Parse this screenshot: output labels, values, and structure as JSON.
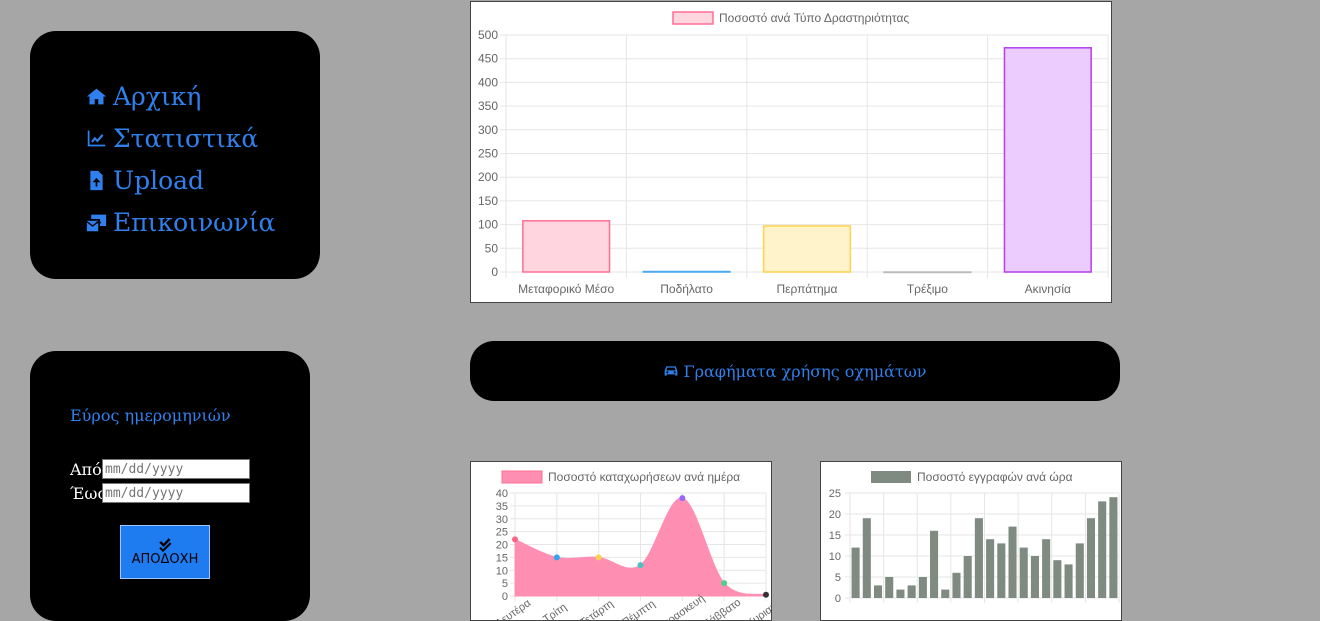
{
  "nav": {
    "items": [
      {
        "label": "Αρχική",
        "icon": "home-icon"
      },
      {
        "label": "Στατιστικά",
        "icon": "line-chart-icon"
      },
      {
        "label": "Upload",
        "icon": "file-upload-icon"
      },
      {
        "label": "Επικοινωνία",
        "icon": "mail-bulk-icon"
      }
    ],
    "color": "#2f80ed"
  },
  "date_filter": {
    "title": "Εύρος ημερομηνιών",
    "from_label": "Από",
    "to_label": "Έως",
    "from_placeholder": "mm/dd/yyyy",
    "to_placeholder": "mm/dd/yyyy",
    "accept_label": "ΑΠΟΔΟΧΗ",
    "accept_icon": "double-check-icon"
  },
  "vehicle_button": {
    "label": "Γραφήματα χρήσης οχημάτων",
    "icon": "car-icon"
  },
  "chart_data": [
    {
      "type": "bar",
      "legend": "Ποσοστό ανά Τύπο Δραστηριότητας",
      "categories": [
        "Μεταφορικό Μέσο",
        "Ποδήλατο",
        "Περπάτημα",
        "Τρέξιμο",
        "Ακινησία"
      ],
      "values": [
        108,
        1,
        97,
        0,
        473
      ],
      "ylim": [
        0,
        500
      ],
      "yticks": [
        0,
        50,
        100,
        150,
        200,
        250,
        300,
        350,
        400,
        450,
        500
      ],
      "grid": true,
      "legend_position": "top",
      "fill_colors": [
        "#ffd6e0",
        "#d6ecff",
        "#fff3cc",
        "#ffffff",
        "#ecccff"
      ],
      "stroke_colors": [
        "#ff6f95",
        "#4aa8f0",
        "#ffd24a",
        "#bbbbbb",
        "#b23ff0"
      ]
    },
    {
      "type": "area",
      "legend": "Ποσοστό καταχωρήσεων ανά ημέρα",
      "categories": [
        "Δευτέρα",
        "Τρίτη",
        "Τετάρτη",
        "Πέμπτη",
        "Παρασκευή",
        "Σάββατο",
        "Κυριακή"
      ],
      "values": [
        22,
        15,
        15,
        12,
        38,
        5,
        0.5
      ],
      "ylim": [
        0,
        40
      ],
      "yticks": [
        0,
        5,
        10,
        15,
        20,
        25,
        30,
        35,
        40
      ],
      "grid": true,
      "legend_position": "top",
      "fill_color": "#ff8fb2",
      "point_colors": [
        "#ff6384",
        "#36a2eb",
        "#ffce56",
        "#4bc0c0",
        "#9966ff",
        "#4dd08a",
        "#333333"
      ]
    },
    {
      "type": "bar",
      "legend": "Ποσοστό εγγραφών ανά ώρα",
      "values": [
        12,
        19,
        3,
        5,
        2,
        3,
        5,
        16,
        2,
        6,
        10,
        19,
        14,
        13,
        17,
        12,
        10,
        14,
        9,
        8,
        13,
        19,
        23,
        24
      ],
      "ylim": [
        0,
        25
      ],
      "yticks": [
        0,
        5,
        10,
        15,
        20,
        25
      ],
      "grid": true,
      "legend_position": "top",
      "fill_color": "#7f8a80"
    }
  ]
}
